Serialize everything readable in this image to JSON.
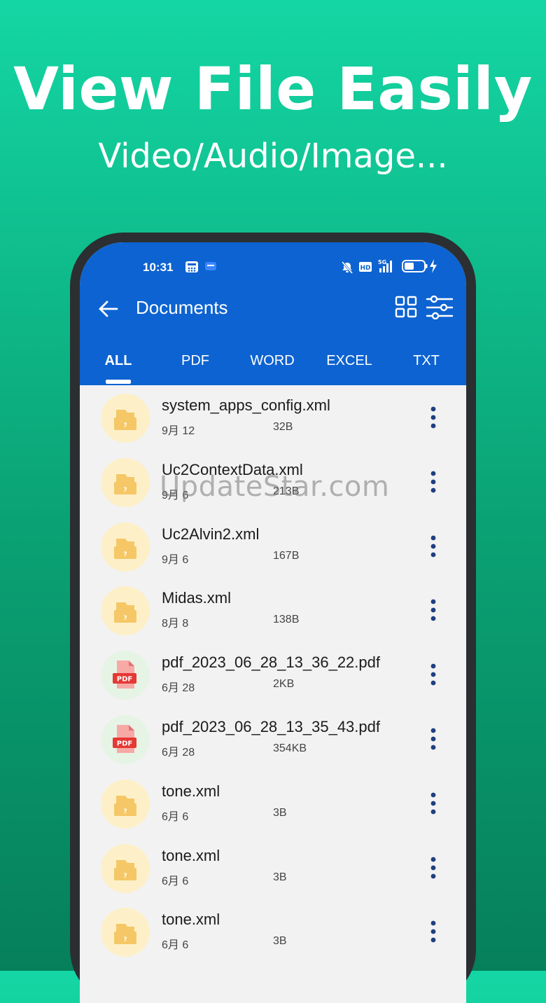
{
  "promo": {
    "headline": "View File Easily",
    "subline": "Video/Audio/Image..."
  },
  "status_bar": {
    "time": "10:31",
    "left_icons": [
      "calculator-icon",
      "zhihu-icon"
    ],
    "right_icons": [
      "mute-icon",
      "hd-icon",
      "5g-signal-icon",
      "battery-icon",
      "charging-icon"
    ]
  },
  "toolbar": {
    "title": "Documents",
    "back_icon": "arrow-left-icon",
    "grid_icon": "grid-view-icon",
    "filter_icon": "filter-sliders-icon"
  },
  "tabs": [
    {
      "label": "ALL",
      "active": true
    },
    {
      "label": "PDF",
      "active": false
    },
    {
      "label": "WORD",
      "active": false
    },
    {
      "label": "EXCEL",
      "active": false
    },
    {
      "label": "TXT",
      "active": false
    }
  ],
  "files": [
    {
      "name": "system_apps_config.xml",
      "date": "9月 12",
      "size": "32B",
      "type": "unknown"
    },
    {
      "name": "Uc2ContextData.xml",
      "date": "9月 6",
      "size": "213B",
      "type": "unknown"
    },
    {
      "name": "Uc2Alvin2.xml",
      "date": "9月 6",
      "size": "167B",
      "type": "unknown"
    },
    {
      "name": "Midas.xml",
      "date": "8月 8",
      "size": "138B",
      "type": "unknown"
    },
    {
      "name": "pdf_2023_06_28_13_36_22.pdf",
      "date": "6月 28",
      "size": "2KB",
      "type": "pdf"
    },
    {
      "name": "pdf_2023_06_28_13_35_43.pdf",
      "date": "6月 28",
      "size": "354KB",
      "type": "pdf"
    },
    {
      "name": "tone.xml",
      "date": "6月 6",
      "size": "3B",
      "type": "unknown"
    },
    {
      "name": "tone.xml",
      "date": "6月 6",
      "size": "3B",
      "type": "unknown"
    },
    {
      "name": "tone.xml",
      "date": "6月 6",
      "size": "3B",
      "type": "unknown"
    }
  ],
  "watermark": "UpdateStar.com",
  "colors": {
    "appbar": "#0d63d1",
    "background_top": "#14d6a4",
    "background_bottom": "#06805a",
    "folder_badge": "#fdf0c8",
    "folder_icon": "#f5c766",
    "pdf_badge": "#e6f4e6",
    "pdf_icon": "#e53935",
    "more_dots": "#1f3f80"
  }
}
